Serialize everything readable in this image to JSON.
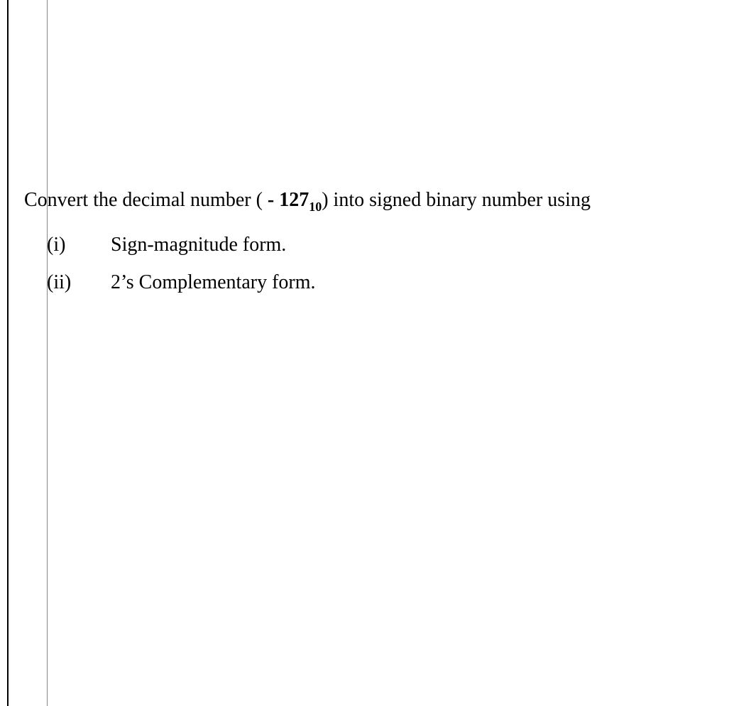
{
  "question": {
    "prefix": "Convert the decimal number (",
    "highlight_part1": " - 127",
    "subscript": "10",
    "suffix": ") into signed binary number using"
  },
  "options": [
    {
      "label": "(i)",
      "text": "Sign-magnitude form."
    },
    {
      "label": "(ii)",
      "text": "2’s Complementary form."
    }
  ]
}
